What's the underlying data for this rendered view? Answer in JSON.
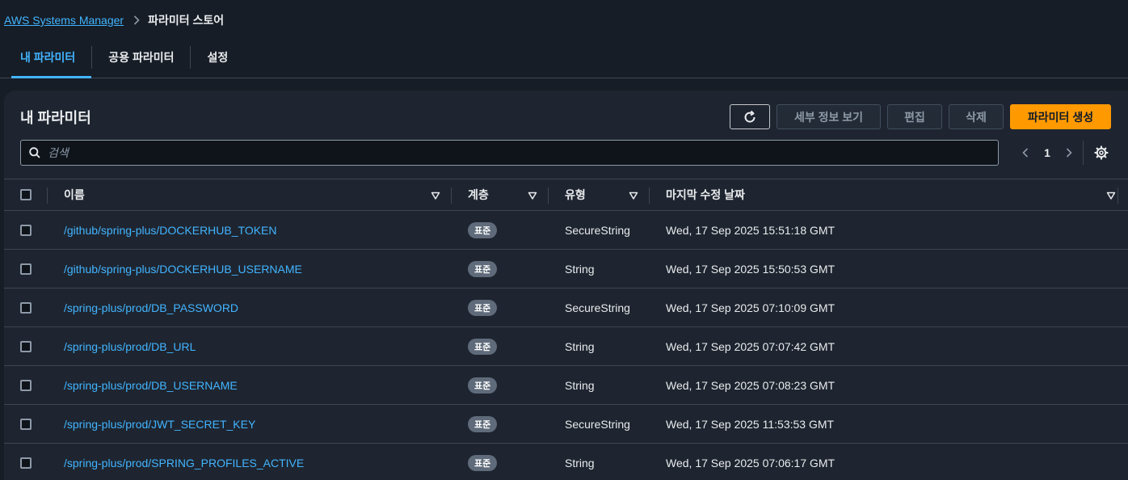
{
  "breadcrumb": {
    "parent": "AWS Systems Manager",
    "current": "파라미터 스토어"
  },
  "tabs": [
    {
      "label": "내 파라미터",
      "active": true
    },
    {
      "label": "공용 파라미터",
      "active": false
    },
    {
      "label": "설정",
      "active": false
    }
  ],
  "panel": {
    "title": "내 파라미터",
    "buttons": {
      "details": "세부 정보 보기",
      "edit": "편집",
      "delete": "삭제",
      "create": "파라미터 생성"
    }
  },
  "search": {
    "placeholder": "검색"
  },
  "pagination": {
    "current_page": "1"
  },
  "table": {
    "headers": {
      "name": "이름",
      "tier": "계층",
      "type": "유형",
      "modified": "마지막 수정 날짜"
    },
    "rows": [
      {
        "name": "/github/spring-plus/DOCKERHUB_TOKEN",
        "tier": "표준",
        "type": "SecureString",
        "modified": "Wed, 17 Sep 2025 15:51:18 GMT"
      },
      {
        "name": "/github/spring-plus/DOCKERHUB_USERNAME",
        "tier": "표준",
        "type": "String",
        "modified": "Wed, 17 Sep 2025 15:50:53 GMT"
      },
      {
        "name": "/spring-plus/prod/DB_PASSWORD",
        "tier": "표준",
        "type": "SecureString",
        "modified": "Wed, 17 Sep 2025 07:10:09 GMT"
      },
      {
        "name": "/spring-plus/prod/DB_URL",
        "tier": "표준",
        "type": "String",
        "modified": "Wed, 17 Sep 2025 07:07:42 GMT"
      },
      {
        "name": "/spring-plus/prod/DB_USERNAME",
        "tier": "표준",
        "type": "String",
        "modified": "Wed, 17 Sep 2025 07:08:23 GMT"
      },
      {
        "name": "/spring-plus/prod/JWT_SECRET_KEY",
        "tier": "표준",
        "type": "SecureString",
        "modified": "Wed, 17 Sep 2025 11:53:53 GMT"
      },
      {
        "name": "/spring-plus/prod/SPRING_PROFILES_ACTIVE",
        "tier": "표준",
        "type": "String",
        "modified": "Wed, 17 Sep 2025 07:06:17 GMT"
      }
    ]
  },
  "colors": {
    "accent": "#42b4ff",
    "primary_button": "#ff9900",
    "background": "#161d26",
    "panel": "#1e2530",
    "badge": "#5f6b7a"
  },
  "icons": {
    "breadcrumb_separator": "chevron-right-icon",
    "refresh": "refresh-icon",
    "search": "search-icon",
    "prev": "chevron-left-icon",
    "next": "chevron-right-icon",
    "settings": "gear-icon",
    "sort": "sort-down-icon"
  }
}
